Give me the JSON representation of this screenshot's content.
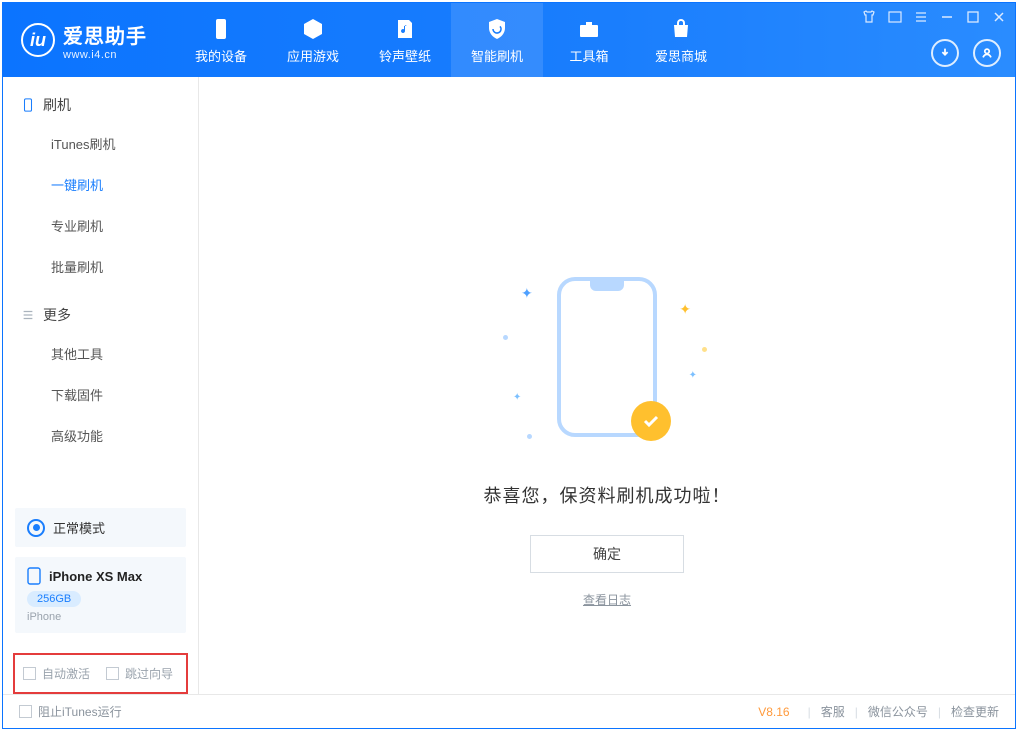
{
  "brand": {
    "name_cn": "爱思助手",
    "url": "www.i4.cn"
  },
  "topTabs": [
    {
      "label": "我的设备"
    },
    {
      "label": "应用游戏"
    },
    {
      "label": "铃声壁纸"
    },
    {
      "label": "智能刷机"
    },
    {
      "label": "工具箱"
    },
    {
      "label": "爱思商城"
    }
  ],
  "sidebar": {
    "section1": {
      "title": "刷机",
      "items": [
        "iTunes刷机",
        "一键刷机",
        "专业刷机",
        "批量刷机"
      ]
    },
    "section2": {
      "title": "更多",
      "items": [
        "其他工具",
        "下载固件",
        "高级功能"
      ]
    },
    "mode": "正常模式",
    "device": {
      "name": "iPhone XS Max",
      "storage": "256GB",
      "type": "iPhone"
    },
    "checks": {
      "auto_activate": "自动激活",
      "skip_guide": "跳过向导"
    }
  },
  "main": {
    "success_text": "恭喜您，保资料刷机成功啦！",
    "ok_btn": "确定",
    "view_log": "查看日志"
  },
  "footer": {
    "block_itunes": "阻止iTunes运行",
    "version": "V8.16",
    "links": [
      "客服",
      "微信公众号",
      "检查更新"
    ]
  }
}
